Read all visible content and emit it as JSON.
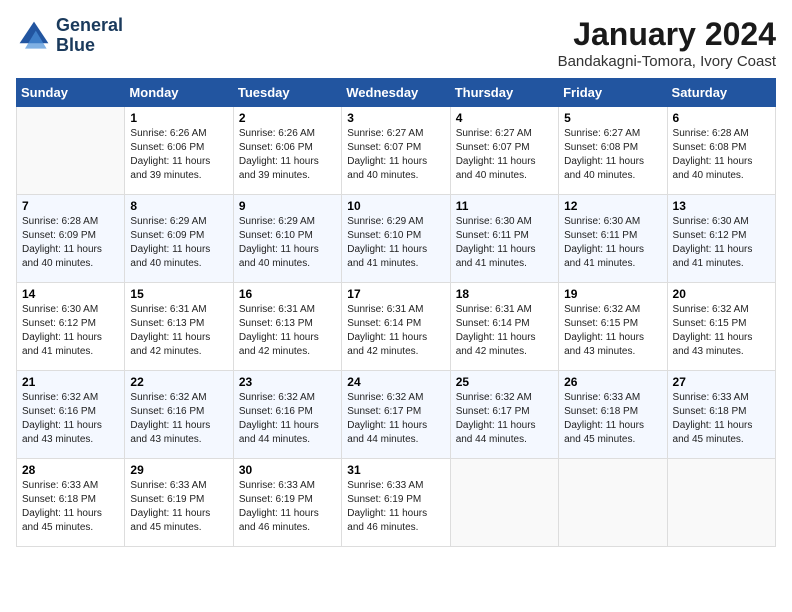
{
  "header": {
    "title": "January 2024",
    "subtitle": "Bandakagni-Tomora, Ivory Coast",
    "logo_line1": "General",
    "logo_line2": "Blue"
  },
  "columns": [
    "Sunday",
    "Monday",
    "Tuesday",
    "Wednesday",
    "Thursday",
    "Friday",
    "Saturday"
  ],
  "weeks": [
    [
      {
        "num": "",
        "info": ""
      },
      {
        "num": "1",
        "info": "Sunrise: 6:26 AM\nSunset: 6:06 PM\nDaylight: 11 hours\nand 39 minutes."
      },
      {
        "num": "2",
        "info": "Sunrise: 6:26 AM\nSunset: 6:06 PM\nDaylight: 11 hours\nand 39 minutes."
      },
      {
        "num": "3",
        "info": "Sunrise: 6:27 AM\nSunset: 6:07 PM\nDaylight: 11 hours\nand 40 minutes."
      },
      {
        "num": "4",
        "info": "Sunrise: 6:27 AM\nSunset: 6:07 PM\nDaylight: 11 hours\nand 40 minutes."
      },
      {
        "num": "5",
        "info": "Sunrise: 6:27 AM\nSunset: 6:08 PM\nDaylight: 11 hours\nand 40 minutes."
      },
      {
        "num": "6",
        "info": "Sunrise: 6:28 AM\nSunset: 6:08 PM\nDaylight: 11 hours\nand 40 minutes."
      }
    ],
    [
      {
        "num": "7",
        "info": "Sunrise: 6:28 AM\nSunset: 6:09 PM\nDaylight: 11 hours\nand 40 minutes."
      },
      {
        "num": "8",
        "info": "Sunrise: 6:29 AM\nSunset: 6:09 PM\nDaylight: 11 hours\nand 40 minutes."
      },
      {
        "num": "9",
        "info": "Sunrise: 6:29 AM\nSunset: 6:10 PM\nDaylight: 11 hours\nand 40 minutes."
      },
      {
        "num": "10",
        "info": "Sunrise: 6:29 AM\nSunset: 6:10 PM\nDaylight: 11 hours\nand 41 minutes."
      },
      {
        "num": "11",
        "info": "Sunrise: 6:30 AM\nSunset: 6:11 PM\nDaylight: 11 hours\nand 41 minutes."
      },
      {
        "num": "12",
        "info": "Sunrise: 6:30 AM\nSunset: 6:11 PM\nDaylight: 11 hours\nand 41 minutes."
      },
      {
        "num": "13",
        "info": "Sunrise: 6:30 AM\nSunset: 6:12 PM\nDaylight: 11 hours\nand 41 minutes."
      }
    ],
    [
      {
        "num": "14",
        "info": "Sunrise: 6:30 AM\nSunset: 6:12 PM\nDaylight: 11 hours\nand 41 minutes."
      },
      {
        "num": "15",
        "info": "Sunrise: 6:31 AM\nSunset: 6:13 PM\nDaylight: 11 hours\nand 42 minutes."
      },
      {
        "num": "16",
        "info": "Sunrise: 6:31 AM\nSunset: 6:13 PM\nDaylight: 11 hours\nand 42 minutes."
      },
      {
        "num": "17",
        "info": "Sunrise: 6:31 AM\nSunset: 6:14 PM\nDaylight: 11 hours\nand 42 minutes."
      },
      {
        "num": "18",
        "info": "Sunrise: 6:31 AM\nSunset: 6:14 PM\nDaylight: 11 hours\nand 42 minutes."
      },
      {
        "num": "19",
        "info": "Sunrise: 6:32 AM\nSunset: 6:15 PM\nDaylight: 11 hours\nand 43 minutes."
      },
      {
        "num": "20",
        "info": "Sunrise: 6:32 AM\nSunset: 6:15 PM\nDaylight: 11 hours\nand 43 minutes."
      }
    ],
    [
      {
        "num": "21",
        "info": "Sunrise: 6:32 AM\nSunset: 6:16 PM\nDaylight: 11 hours\nand 43 minutes."
      },
      {
        "num": "22",
        "info": "Sunrise: 6:32 AM\nSunset: 6:16 PM\nDaylight: 11 hours\nand 43 minutes."
      },
      {
        "num": "23",
        "info": "Sunrise: 6:32 AM\nSunset: 6:16 PM\nDaylight: 11 hours\nand 44 minutes."
      },
      {
        "num": "24",
        "info": "Sunrise: 6:32 AM\nSunset: 6:17 PM\nDaylight: 11 hours\nand 44 minutes."
      },
      {
        "num": "25",
        "info": "Sunrise: 6:32 AM\nSunset: 6:17 PM\nDaylight: 11 hours\nand 44 minutes."
      },
      {
        "num": "26",
        "info": "Sunrise: 6:33 AM\nSunset: 6:18 PM\nDaylight: 11 hours\nand 45 minutes."
      },
      {
        "num": "27",
        "info": "Sunrise: 6:33 AM\nSunset: 6:18 PM\nDaylight: 11 hours\nand 45 minutes."
      }
    ],
    [
      {
        "num": "28",
        "info": "Sunrise: 6:33 AM\nSunset: 6:18 PM\nDaylight: 11 hours\nand 45 minutes."
      },
      {
        "num": "29",
        "info": "Sunrise: 6:33 AM\nSunset: 6:19 PM\nDaylight: 11 hours\nand 45 minutes."
      },
      {
        "num": "30",
        "info": "Sunrise: 6:33 AM\nSunset: 6:19 PM\nDaylight: 11 hours\nand 46 minutes."
      },
      {
        "num": "31",
        "info": "Sunrise: 6:33 AM\nSunset: 6:19 PM\nDaylight: 11 hours\nand 46 minutes."
      },
      {
        "num": "",
        "info": ""
      },
      {
        "num": "",
        "info": ""
      },
      {
        "num": "",
        "info": ""
      }
    ]
  ]
}
